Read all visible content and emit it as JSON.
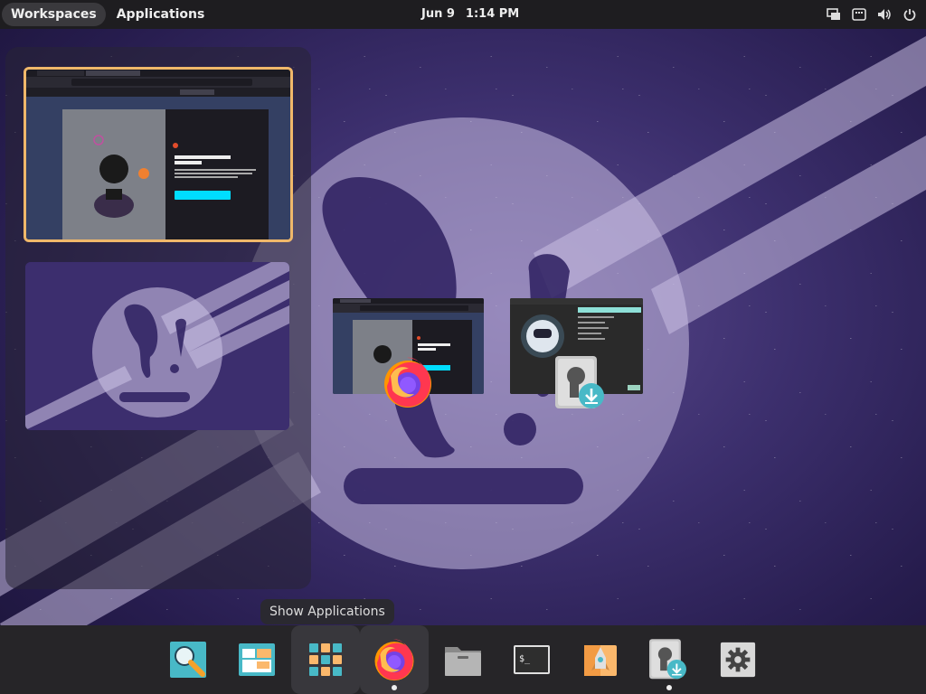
{
  "topbar": {
    "workspaces_label": "Workspaces",
    "applications_label": "Applications",
    "date": "Jun 9",
    "time": "1:14 PM",
    "tray_icons": [
      "display-icon",
      "keyboard-icon",
      "volume-icon",
      "power-icon"
    ]
  },
  "workspaces": {
    "ws1": {
      "tabs": [
        "Welcome to Firefox",
        "Warning: Potential Secur"
      ],
      "heading": "Open up an amazing internet",
      "body": "Each web browser is made by a non-profit. It's out there to make browsing safe, fast and private on the web.",
      "cta": "Get Started with Firefox Account",
      "notice_button": "Choose What I Share"
    }
  },
  "window_previews": [
    {
      "app": "Firefox",
      "heading": "Open up an amazing internet",
      "icon": "firefox-icon"
    },
    {
      "app": "Pop!_Shop Installer",
      "icon": "installer-icon"
    }
  ],
  "tooltip": {
    "text": "Show Applications"
  },
  "dock": {
    "items": [
      {
        "name": "search-app-icon",
        "running": false
      },
      {
        "name": "launcher-app-icon",
        "running": false
      },
      {
        "name": "show-applications-icon",
        "running": false,
        "highlighted": true
      },
      {
        "name": "firefox-icon",
        "running": true,
        "highlighted": true
      },
      {
        "name": "files-icon",
        "running": false
      },
      {
        "name": "terminal-icon",
        "running": false
      },
      {
        "name": "shop-icon",
        "running": false
      },
      {
        "name": "installer-icon",
        "running": true
      },
      {
        "name": "settings-icon",
        "running": false
      }
    ],
    "terminal_glyph": "$_"
  },
  "colors": {
    "accent": "#f0b86a",
    "topbar": "#1e1d20",
    "dock": "#262528",
    "teal": "#48b9c7",
    "yellow": "#fbb86c"
  }
}
